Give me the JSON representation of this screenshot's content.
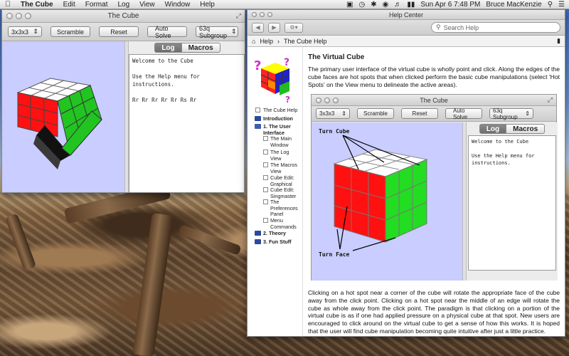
{
  "menubar": {
    "app_name": "The Cube",
    "items": [
      "Edit",
      "Format",
      "Log",
      "View",
      "Window",
      "Help"
    ],
    "datetime": "Sun Apr 6  7:48 PM",
    "user": "Bruce MacKenzie"
  },
  "cube_window": {
    "title": "The Cube",
    "size_popup": "3x3x3",
    "buttons": {
      "scramble": "Scramble",
      "reset": "Reset",
      "auto_solve": "Auto Solve"
    },
    "subgroup_popup": "63q Subgroup",
    "tabs": {
      "log": "Log",
      "macros": "Macros"
    },
    "log_text": "Welcome to the Cube\n\nUse the Help menu for instructions.\n\nRr Rr Rr Rr Rr Rs Rr"
  },
  "help_window": {
    "title": "Help Center",
    "search_placeholder": "Search Help",
    "breadcrumb": {
      "root": "Help",
      "current": "The Cube Help"
    },
    "toc": {
      "header": "The Cube Help",
      "items": [
        {
          "label": "Introduction",
          "bold": true
        },
        {
          "label": "1. The User Interface",
          "bold": true
        },
        {
          "label": "The Main Window",
          "bold": false
        },
        {
          "label": "The Log View",
          "bold": false
        },
        {
          "label": "The Macros View",
          "bold": false
        },
        {
          "label": "Cube Edit: Graphical",
          "bold": false
        },
        {
          "label": "Cube Edit: Singmaster",
          "bold": false
        },
        {
          "label": "The Preferences Panel",
          "bold": false
        },
        {
          "label": "Menu Commands",
          "bold": false
        },
        {
          "label": "2. Theory",
          "bold": true
        },
        {
          "label": "3. Fun Stuff",
          "bold": true
        }
      ]
    },
    "content": {
      "title": "The Virtual Cube",
      "para1": "The primary user interface of the virtual cube is wholly point and click. Along the edges of the cube faces are hot spots that when clicked perform the basic cube manipulations (select 'Hot Spots' on the View menu to delineate the active areas).",
      "para2": "Clicking on a hot spot near a corner of the cube will rotate the appropriate face of the cube away from the click point. Clicking on a hot spot near the middle of an edge will rotate the cube as whole away from the click point. The paradigm is that clicking on a portion of the virtual cube is as if one had applied pressure on a physical cube at that spot. New users are encouraged to click around on the virtual cube to get a sense of how this works. It is hoped that the user will find cube manipulation becoming quite intuitive after just a little practice.",
      "screenshot": {
        "title": "The Cube",
        "size_popup": "3x3x3",
        "scramble": "Scramble",
        "reset": "Reset",
        "auto_solve": "Auto Solve",
        "subgroup_popup": "63q Subgroup",
        "tabs": {
          "log": "Log",
          "macros": "Macros"
        },
        "log_text": "Welcome to the Cube\n\nUse the Help menu for\ninstructions.",
        "annot_turn_cube": "Turn Cube",
        "annot_turn_face": "Turn Face"
      }
    }
  }
}
